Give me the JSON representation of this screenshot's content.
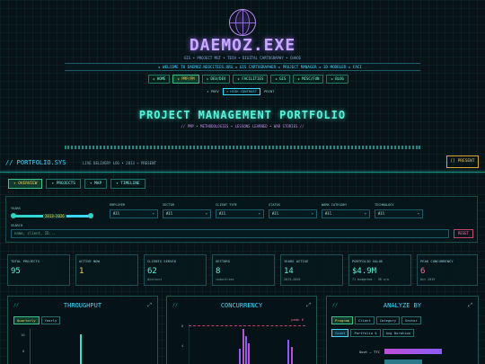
{
  "site": {
    "title": "DAEMOZ.EXE",
    "tagline": "GIS • PROJECT MGT • TECH • DIGITAL CARTOGRAPHY • CHAOS",
    "ticker": "★ WELCOME TO DAEMOZ.NEOCITIES.ORG ★ GIS CARTOGRAPHER ★ PROJECT MANAGER ★ 3D MODELER ★ FACI"
  },
  "nav": [
    "★ HOME",
    "★ PMP/PM",
    "★ DEV/DEV",
    "★ FACILITIES",
    "★ GIS",
    "★ MISC/FUN",
    "★ BLOG"
  ],
  "nav_active_index": 1,
  "lang": {
    "left": "◂ PREV",
    "mid": "◂ HIGH CONTRAST",
    "right": "PRINT"
  },
  "page": {
    "title": "PROJECT MANAGEMENT PORTFOLIO",
    "subtitle": "// PMP • METHODOLOGIES • LESSONS LEARNED • WAR STORIES //"
  },
  "sys": {
    "title": "// PORTFOLIO.SYS",
    "meta": "LIVE DELIVERY LOG • 2013 → PRESENT",
    "present_btn": "[] PRESENT"
  },
  "tabs": [
    "✦ OVERVIEW",
    "✦ PROJECTS",
    "✦ MAP",
    "✦ TIMELINE"
  ],
  "filters": {
    "years_label": "YEARS",
    "years_value": "2013–2026",
    "years_range": [
      0,
      1
    ],
    "search_label": "SEARCH",
    "search_placeholder": "name, client, ID...",
    "reset": "RESET",
    "selects": [
      {
        "label": "EMPLOYER",
        "value": "All"
      },
      {
        "label": "SECTOR",
        "value": "All"
      },
      {
        "label": "CLIENT TYPE",
        "value": "All"
      },
      {
        "label": "STATUS",
        "value": "All"
      },
      {
        "label": "WORK CATEGORY",
        "value": "All"
      },
      {
        "label": "TECHNOLOGY",
        "value": "All"
      }
    ]
  },
  "stats": [
    {
      "label": "TOTAL PROJECTS",
      "value": "95",
      "sub": "",
      "color": "#5ff0d8"
    },
    {
      "label": "ACTIVE NOW",
      "value": "1",
      "sub": "",
      "color": "#f3d25a"
    },
    {
      "label": "CLIENTS SERVED",
      "value": "62",
      "sub": "distinct",
      "color": "#5ff0d8"
    },
    {
      "label": "SECTORS",
      "value": "8",
      "sub": "industries",
      "color": "#5ff0d8"
    },
    {
      "label": "YEARS ACTIVE",
      "value": "14",
      "sub": "2013–2026",
      "color": "#5ff0d8"
    },
    {
      "label": "PORTFOLIO VALUE",
      "value": "$4.9M",
      "sub": "71 budgeted · 38 n/a",
      "color": "#5ff0d8"
    },
    {
      "label": "PEAK CONCURRENCY",
      "value": "6",
      "sub": "Oct 2019",
      "color": "#ff6a9a"
    }
  ],
  "panels": {
    "throughput": {
      "title": "THROUGHPUT",
      "toggle": [
        "Quarterly",
        "Yearly"
      ],
      "ticks": [
        "10",
        "8"
      ]
    },
    "concurrency": {
      "title": "CONCURRENCY",
      "peak": "peak 6",
      "ticks": [
        "6",
        "4"
      ]
    },
    "analyze": {
      "title": "ANALYZE BY",
      "tabs": [
        "Program",
        "Client",
        "Category",
        "Sector"
      ],
      "metrics": [
        "Count",
        "Portfolio $",
        "Avg Duration"
      ],
      "bar_label": "Govt – TTC"
    }
  },
  "colors": {
    "accent": "#5ff0d8",
    "gold": "#f3d25a",
    "pink": "#ff6a9a",
    "blue": "#3fd6ff",
    "purple": "#c9a8ff"
  }
}
